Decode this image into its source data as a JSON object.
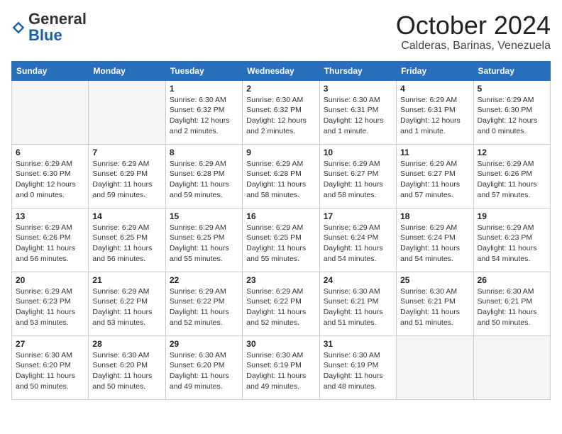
{
  "header": {
    "logo_general": "General",
    "logo_blue": "Blue",
    "month": "October 2024",
    "location": "Calderas, Barinas, Venezuela"
  },
  "days_of_week": [
    "Sunday",
    "Monday",
    "Tuesday",
    "Wednesday",
    "Thursday",
    "Friday",
    "Saturday"
  ],
  "weeks": [
    [
      {
        "day": "",
        "info": ""
      },
      {
        "day": "",
        "info": ""
      },
      {
        "day": "1",
        "info": "Sunrise: 6:30 AM\nSunset: 6:32 PM\nDaylight: 12 hours\nand 2 minutes."
      },
      {
        "day": "2",
        "info": "Sunrise: 6:30 AM\nSunset: 6:32 PM\nDaylight: 12 hours\nand 2 minutes."
      },
      {
        "day": "3",
        "info": "Sunrise: 6:30 AM\nSunset: 6:31 PM\nDaylight: 12 hours\nand 1 minute."
      },
      {
        "day": "4",
        "info": "Sunrise: 6:29 AM\nSunset: 6:31 PM\nDaylight: 12 hours\nand 1 minute."
      },
      {
        "day": "5",
        "info": "Sunrise: 6:29 AM\nSunset: 6:30 PM\nDaylight: 12 hours\nand 0 minutes."
      }
    ],
    [
      {
        "day": "6",
        "info": "Sunrise: 6:29 AM\nSunset: 6:30 PM\nDaylight: 12 hours\nand 0 minutes."
      },
      {
        "day": "7",
        "info": "Sunrise: 6:29 AM\nSunset: 6:29 PM\nDaylight: 11 hours\nand 59 minutes."
      },
      {
        "day": "8",
        "info": "Sunrise: 6:29 AM\nSunset: 6:28 PM\nDaylight: 11 hours\nand 59 minutes."
      },
      {
        "day": "9",
        "info": "Sunrise: 6:29 AM\nSunset: 6:28 PM\nDaylight: 11 hours\nand 58 minutes."
      },
      {
        "day": "10",
        "info": "Sunrise: 6:29 AM\nSunset: 6:27 PM\nDaylight: 11 hours\nand 58 minutes."
      },
      {
        "day": "11",
        "info": "Sunrise: 6:29 AM\nSunset: 6:27 PM\nDaylight: 11 hours\nand 57 minutes."
      },
      {
        "day": "12",
        "info": "Sunrise: 6:29 AM\nSunset: 6:26 PM\nDaylight: 11 hours\nand 57 minutes."
      }
    ],
    [
      {
        "day": "13",
        "info": "Sunrise: 6:29 AM\nSunset: 6:26 PM\nDaylight: 11 hours\nand 56 minutes."
      },
      {
        "day": "14",
        "info": "Sunrise: 6:29 AM\nSunset: 6:25 PM\nDaylight: 11 hours\nand 56 minutes."
      },
      {
        "day": "15",
        "info": "Sunrise: 6:29 AM\nSunset: 6:25 PM\nDaylight: 11 hours\nand 55 minutes."
      },
      {
        "day": "16",
        "info": "Sunrise: 6:29 AM\nSunset: 6:25 PM\nDaylight: 11 hours\nand 55 minutes."
      },
      {
        "day": "17",
        "info": "Sunrise: 6:29 AM\nSunset: 6:24 PM\nDaylight: 11 hours\nand 54 minutes."
      },
      {
        "day": "18",
        "info": "Sunrise: 6:29 AM\nSunset: 6:24 PM\nDaylight: 11 hours\nand 54 minutes."
      },
      {
        "day": "19",
        "info": "Sunrise: 6:29 AM\nSunset: 6:23 PM\nDaylight: 11 hours\nand 54 minutes."
      }
    ],
    [
      {
        "day": "20",
        "info": "Sunrise: 6:29 AM\nSunset: 6:23 PM\nDaylight: 11 hours\nand 53 minutes."
      },
      {
        "day": "21",
        "info": "Sunrise: 6:29 AM\nSunset: 6:22 PM\nDaylight: 11 hours\nand 53 minutes."
      },
      {
        "day": "22",
        "info": "Sunrise: 6:29 AM\nSunset: 6:22 PM\nDaylight: 11 hours\nand 52 minutes."
      },
      {
        "day": "23",
        "info": "Sunrise: 6:29 AM\nSunset: 6:22 PM\nDaylight: 11 hours\nand 52 minutes."
      },
      {
        "day": "24",
        "info": "Sunrise: 6:30 AM\nSunset: 6:21 PM\nDaylight: 11 hours\nand 51 minutes."
      },
      {
        "day": "25",
        "info": "Sunrise: 6:30 AM\nSunset: 6:21 PM\nDaylight: 11 hours\nand 51 minutes."
      },
      {
        "day": "26",
        "info": "Sunrise: 6:30 AM\nSunset: 6:21 PM\nDaylight: 11 hours\nand 50 minutes."
      }
    ],
    [
      {
        "day": "27",
        "info": "Sunrise: 6:30 AM\nSunset: 6:20 PM\nDaylight: 11 hours\nand 50 minutes."
      },
      {
        "day": "28",
        "info": "Sunrise: 6:30 AM\nSunset: 6:20 PM\nDaylight: 11 hours\nand 50 minutes."
      },
      {
        "day": "29",
        "info": "Sunrise: 6:30 AM\nSunset: 6:20 PM\nDaylight: 11 hours\nand 49 minutes."
      },
      {
        "day": "30",
        "info": "Sunrise: 6:30 AM\nSunset: 6:19 PM\nDaylight: 11 hours\nand 49 minutes."
      },
      {
        "day": "31",
        "info": "Sunrise: 6:30 AM\nSunset: 6:19 PM\nDaylight: 11 hours\nand 48 minutes."
      },
      {
        "day": "",
        "info": ""
      },
      {
        "day": "",
        "info": ""
      }
    ]
  ]
}
